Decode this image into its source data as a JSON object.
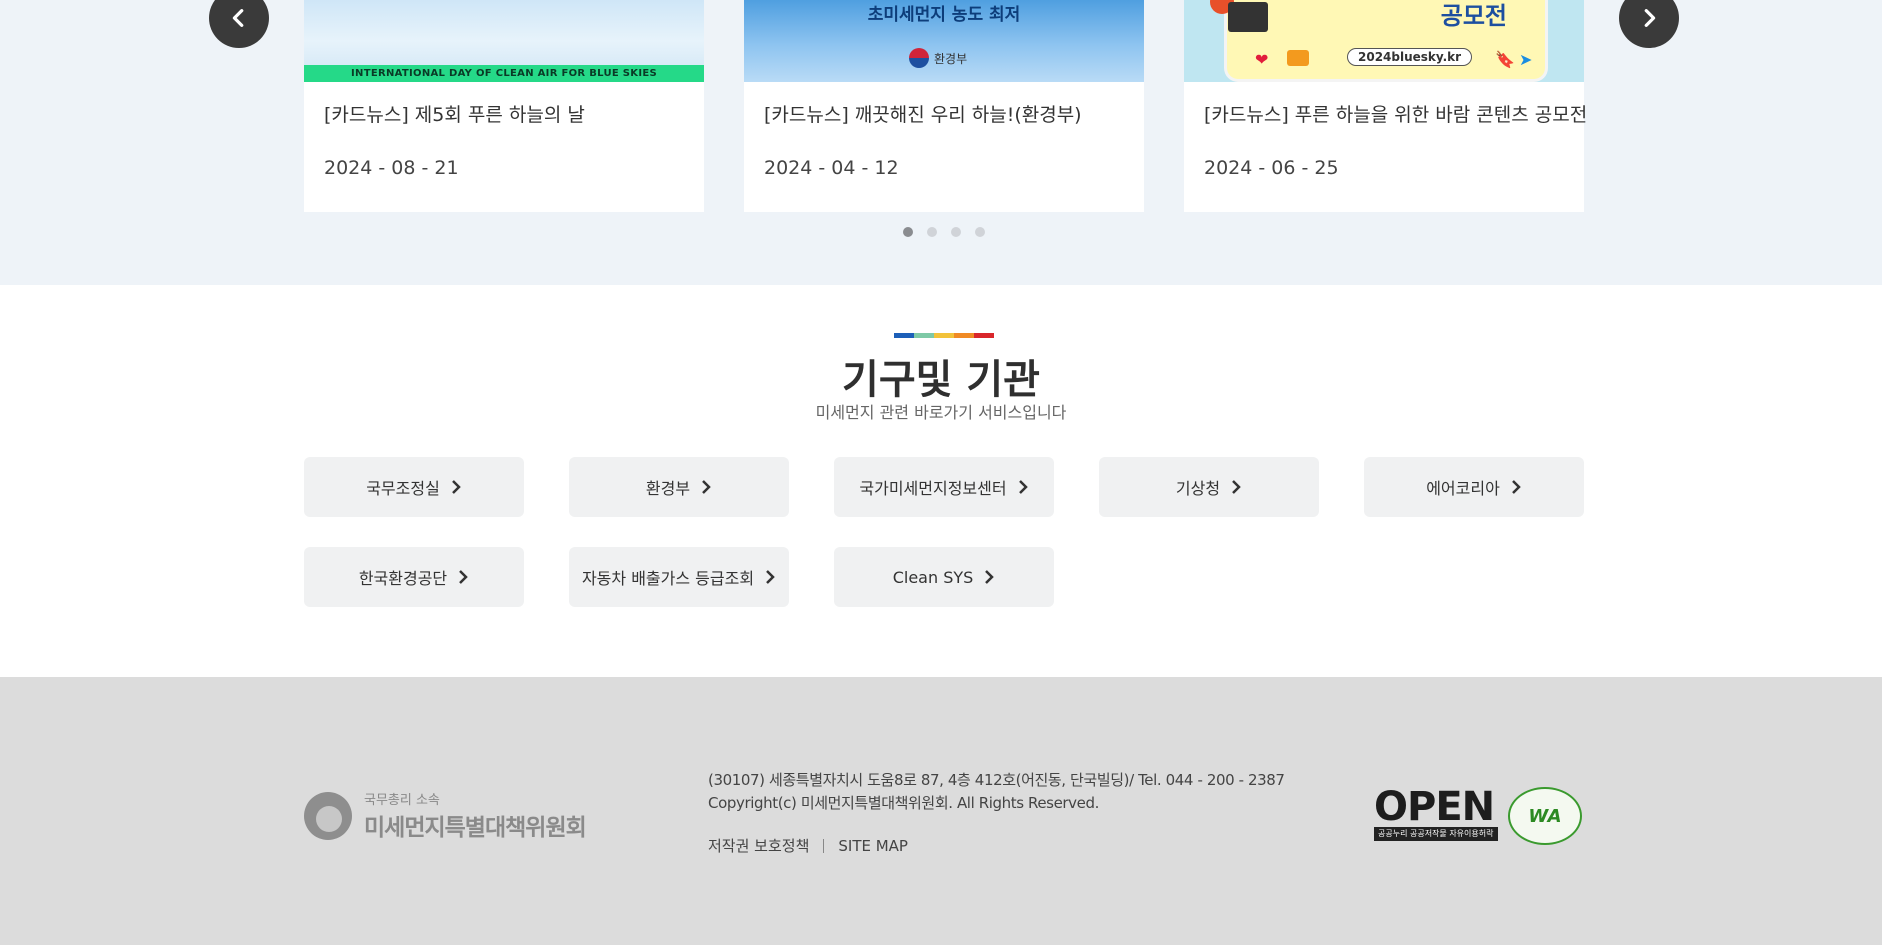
{
  "news": {
    "cards": [
      {
        "title": "[카드뉴스] 제5회 푸른 하늘의 날",
        "date": "2024 - 08 - 21",
        "banner_text": "INTERNATIONAL DAY OF CLEAN AIR FOR BLUE SKIES"
      },
      {
        "title": "[카드뉴스] 깨끗해진 우리 하늘!(환경부)",
        "date": "2024 - 04 - 12",
        "banner_text": "초미세먼지 농도 최저",
        "ministry": "환경부"
      },
      {
        "title": "[카드뉴스] 푸른 하늘을 위한 바람 콘텐츠 공모전",
        "date": "2024 - 06 - 25",
        "banner_text": "공모전",
        "banner_url": "2024bluesky.kr"
      }
    ],
    "prev_icon": "chevron-left-icon",
    "next_icon": "chevron-right-icon",
    "pages": 4,
    "active_page": 1
  },
  "orgs": {
    "title": "기구및 기관",
    "subtitle": "미세먼지 관련 바로가기 서비스입니다",
    "accent_colors": [
      "#1d5fb8",
      "#7ec9a6",
      "#f2c23a",
      "#f08a24",
      "#d9262b"
    ],
    "links": [
      {
        "label": "국무조정실"
      },
      {
        "label": "환경부"
      },
      {
        "label": "국가미세먼지정보센터"
      },
      {
        "label": "기상청"
      },
      {
        "label": "에어코리아"
      },
      {
        "label": "한국환경공단"
      },
      {
        "label": "자동차 배출가스 등급조회"
      },
      {
        "label": "Clean SYS"
      }
    ]
  },
  "footer": {
    "logo_small": "국무총리 소속",
    "logo_name": "미세먼지특별대책위원회",
    "address": "(30107) 세종특별자치시 도움8로 87, 4층 412호(어진동, 단국빌딩)/ Tel. 044 - 200 - 2387",
    "copyright": "Copyright(c) 미세먼지특별대책위원회. All Rights Reserved.",
    "links": [
      "저작권 보호정책",
      "SITE MAP"
    ],
    "open_badge": "OPEN",
    "open_badge_sub": "공공누리 공공저작물 자유이용허락",
    "wa_badge": "WA"
  }
}
